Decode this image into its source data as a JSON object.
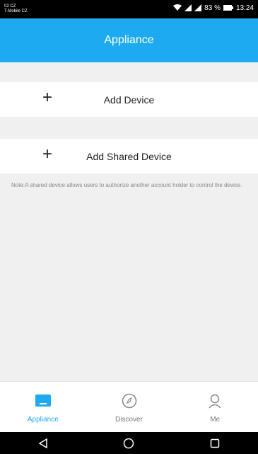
{
  "status": {
    "carrier_line1": "02 CZ",
    "carrier_line2": "T-Mobile CZ",
    "battery": "83 %",
    "time": "13:24"
  },
  "header": {
    "title": "Appliance"
  },
  "actions": {
    "add_device": {
      "plus": "+",
      "label": "Add Device"
    },
    "add_shared": {
      "plus": "+",
      "label": "Add Shared Device"
    }
  },
  "note": "Note:A shared device allows users to authorize another account holder to control the device.",
  "tabs": [
    {
      "label": "Appliance",
      "icon": "appliance-icon",
      "active": true
    },
    {
      "label": "Discover",
      "icon": "compass-icon",
      "active": false
    },
    {
      "label": "Me",
      "icon": "person-icon",
      "active": false
    }
  ],
  "colors": {
    "accent": "#1eaaf1",
    "background": "#f0f0f0"
  }
}
